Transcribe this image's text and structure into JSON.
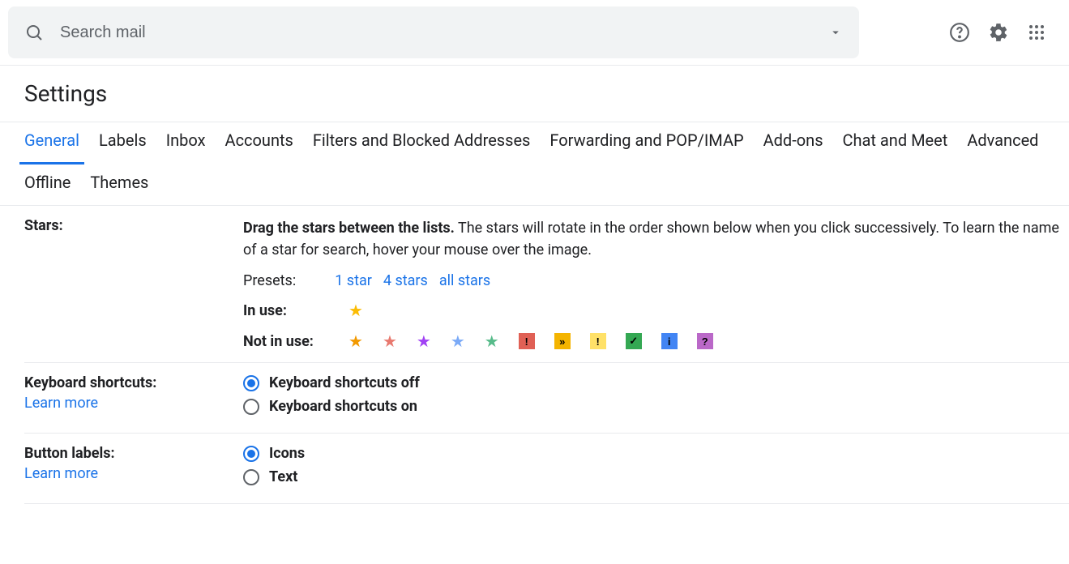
{
  "search": {
    "placeholder": "Search mail"
  },
  "page_title": "Settings",
  "tabs": [
    "General",
    "Labels",
    "Inbox",
    "Accounts",
    "Filters and Blocked Addresses",
    "Forwarding and POP/IMAP",
    "Add-ons",
    "Chat and Meet",
    "Advanced",
    "Offline",
    "Themes"
  ],
  "active_tab": "General",
  "stars": {
    "label": "Stars:",
    "desc_bold": "Drag the stars between the lists.",
    "desc_rest": "  The stars will rotate in the order shown below when you click successively. To learn the name of a star for search, hover your mouse over the image.",
    "presets_label": "Presets:",
    "presets": [
      "1 star",
      "4 stars",
      "all stars"
    ],
    "in_use_label": "In use:",
    "not_in_use_label": "Not in use:",
    "in_use": [
      {
        "type": "star",
        "color": "#fbbc04"
      }
    ],
    "not_in_use": [
      {
        "type": "star",
        "color": "#f29900"
      },
      {
        "type": "star",
        "color": "#e8796f"
      },
      {
        "type": "star",
        "color": "#a142f4"
      },
      {
        "type": "star",
        "color": "#7baaf7"
      },
      {
        "type": "star",
        "color": "#57bb8a"
      },
      {
        "type": "square",
        "bg": "#e06055",
        "glyph": "!",
        "fg": "#000"
      },
      {
        "type": "square",
        "bg": "#f4b400",
        "glyph": "»",
        "fg": "#000"
      },
      {
        "type": "square",
        "bg": "#ffe168",
        "glyph": "!",
        "fg": "#000"
      },
      {
        "type": "square",
        "bg": "#34a853",
        "glyph": "✓",
        "fg": "#000"
      },
      {
        "type": "square",
        "bg": "#4285f4",
        "glyph": "i",
        "fg": "#000"
      },
      {
        "type": "square",
        "bg": "#ba68c8",
        "glyph": "?",
        "fg": "#000"
      }
    ]
  },
  "keyboard": {
    "label": "Keyboard shortcuts:",
    "learn": "Learn more",
    "options": [
      "Keyboard shortcuts off",
      "Keyboard shortcuts on"
    ],
    "selected": 0
  },
  "buttons": {
    "label": "Button labels:",
    "learn": "Learn more",
    "options": [
      "Icons",
      "Text"
    ],
    "selected": 0
  }
}
